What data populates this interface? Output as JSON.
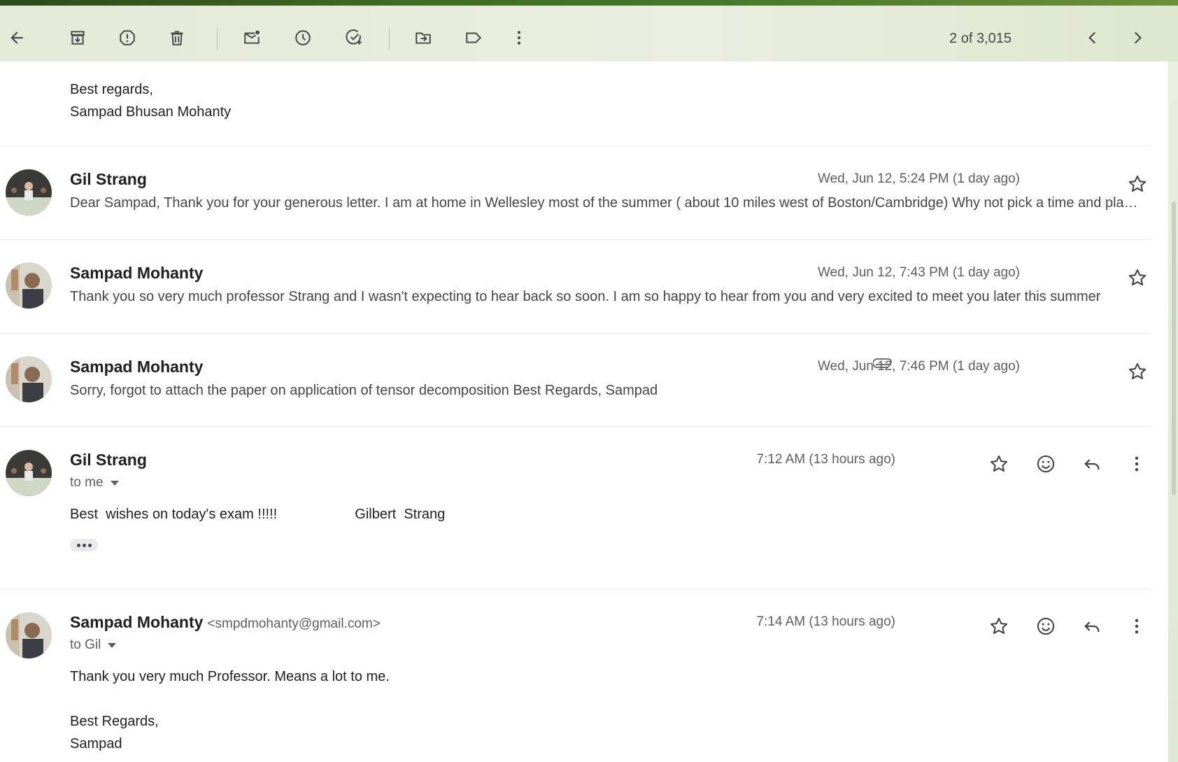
{
  "toolbar": {
    "counter": "2 of 3,015",
    "icons": [
      "back-arrow-icon",
      "archive-icon",
      "report-spam-icon",
      "delete-icon",
      "mark-unread-icon",
      "snooze-icon",
      "add-to-tasks-icon",
      "move-to-icon",
      "label-icon",
      "more-vertical-icon",
      "chevron-left-icon",
      "chevron-right-icon"
    ]
  },
  "previous_message_tail": {
    "line1": "Best regards,",
    "line2": "Sampad Bhusan Mohanty"
  },
  "collapsed_messages": [
    {
      "sender": "Gil Strang",
      "date": "Wed, Jun 12, 5:24 PM (1 day ago)",
      "snippet": "Dear Sampad, Thank you for your generous letter. I am at home in Wellesley most of the summer ( about 10 miles west of Boston/Cambridge) Why not pick a time and place that works for you",
      "has_attachment": false
    },
    {
      "sender": "Sampad Mohanty",
      "date": "Wed, Jun 12, 7:43 PM (1 day ago)",
      "snippet": "Thank you so very much professor Strang and I wasn't expecting to hear back so soon. I am so happy to hear from you and very excited to meet you later this summer",
      "has_attachment": false
    },
    {
      "sender": "Sampad Mohanty",
      "date": "Wed, Jun 12, 7:46 PM (1 day ago)",
      "snippet": "Sorry, forgot to attach the paper on application of tensor decomposition Best Regards, Sampad",
      "has_attachment": true
    }
  ],
  "expanded_messages": [
    {
      "sender": "Gil Strang",
      "email": "",
      "to": "to me",
      "time": "7:12 AM (13 hours ago)",
      "body": "Best  wishes on today's exam !!!!!                    Gilbert  Strang"
    },
    {
      "sender": "Sampad Mohanty",
      "email": "<smpdmohanty@gmail.com>",
      "to": "to Gil",
      "time": "7:14 AM (13 hours ago)",
      "body_line1": "Thank you very much Professor. Means a lot to me.",
      "body_line2": "Best Regards,",
      "body_line3": "Sampad"
    }
  ],
  "colors": {
    "accent_green": "#3f6b23",
    "text_primary": "#1f1f1f",
    "text_secondary": "#444746"
  }
}
